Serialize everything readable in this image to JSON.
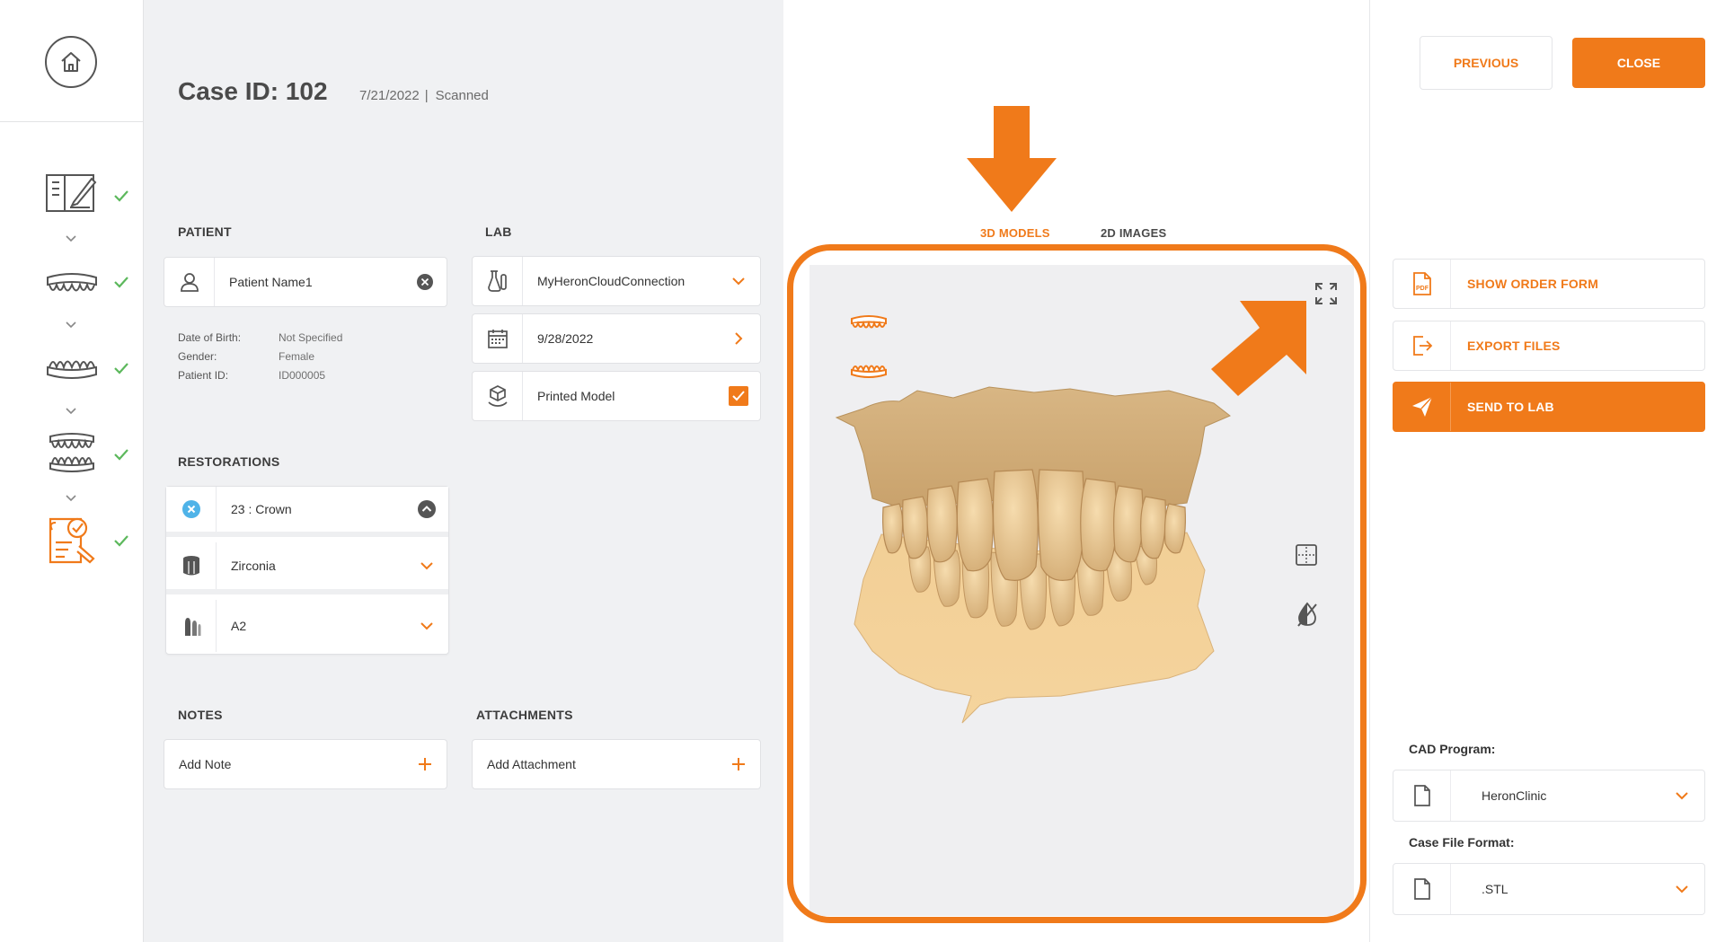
{
  "case": {
    "title": "Case ID: 102",
    "date": "7/21/2022",
    "separator": "|",
    "status": "Scanned"
  },
  "nav": {
    "steps": [
      {
        "icon": "order-form-icon",
        "done": true
      },
      {
        "icon": "upper-jaw-icon",
        "done": true
      },
      {
        "icon": "lower-jaw-icon",
        "done": true
      },
      {
        "icon": "bite-scan-icon",
        "done": true
      },
      {
        "icon": "review-checklist-icon",
        "done": true,
        "active": true
      }
    ]
  },
  "patient": {
    "section_label": "PATIENT",
    "name": "Patient Name1",
    "dob_label": "Date of Birth:",
    "dob_value": "Not Specified",
    "gender_label": "Gender:",
    "gender_value": "Female",
    "id_label": "Patient ID:",
    "id_value": "ID000005"
  },
  "lab": {
    "section_label": "LAB",
    "connection": "MyHeronCloudConnection",
    "due_date": "9/28/2022",
    "printed_model_label": "Printed Model",
    "printed_model_checked": true
  },
  "restorations": {
    "section_label": "RESTORATIONS",
    "tooth": "23 : Crown",
    "material": "Zirconia",
    "shade": "A2"
  },
  "notes": {
    "section_label": "NOTES",
    "placeholder": "Add Note"
  },
  "attachments": {
    "section_label": "ATTACHMENTS",
    "placeholder": "Add Attachment"
  },
  "viewer": {
    "tabs": [
      {
        "label": "3D MODELS",
        "active": true
      },
      {
        "label": "2D IMAGES",
        "active": false
      }
    ]
  },
  "actions": {
    "previous": "PREVIOUS",
    "close": "CLOSE",
    "show_order_form": "SHOW ORDER FORM",
    "export_files": "EXPORT FILES",
    "send_to_lab": "SEND TO LAB",
    "pdf_tag": "PDF"
  },
  "cad": {
    "label": "CAD Program:",
    "value": "HeronClinic"
  },
  "format": {
    "label": "Case File Format:",
    "value": ".STL"
  },
  "colors": {
    "accent": "#f07a1a",
    "check": "#5cb85c",
    "panel": "#f0f1f3"
  }
}
